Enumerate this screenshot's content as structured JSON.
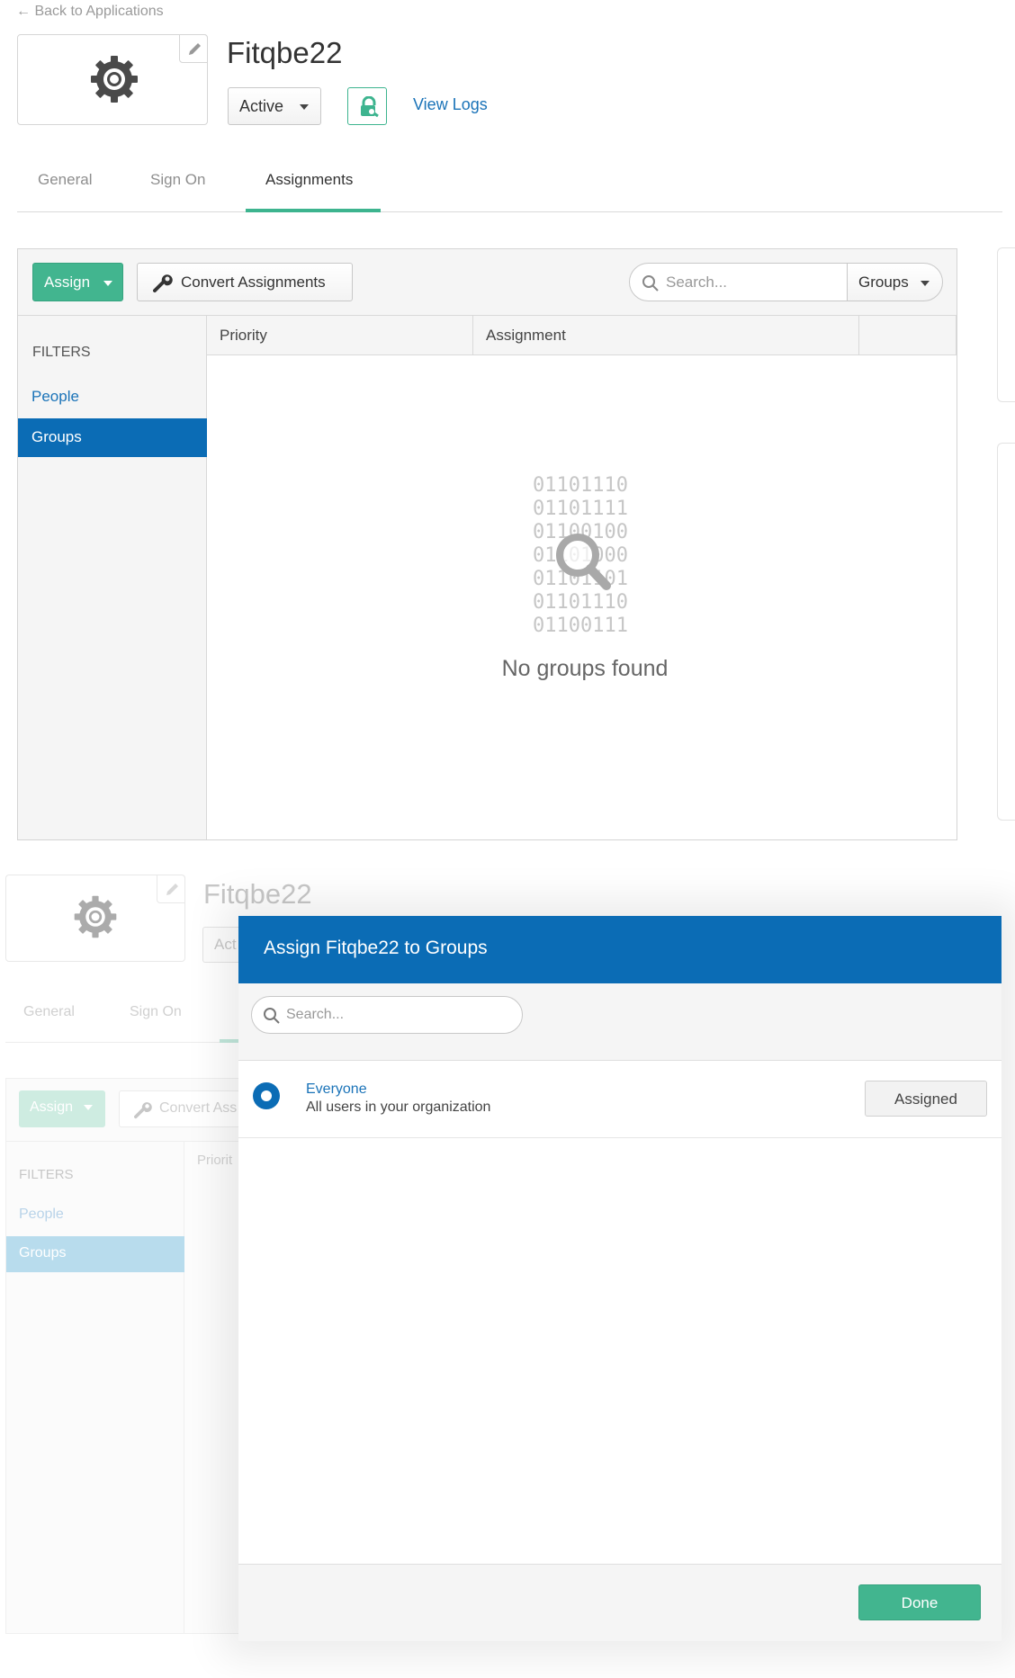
{
  "top": {
    "back_link": "← Back to Applications",
    "app_title": "Fitqbe22",
    "status": "Active",
    "view_logs": "View Logs",
    "tabs": [
      {
        "label": "General"
      },
      {
        "label": "Sign On"
      },
      {
        "label": "Assignments",
        "active": true
      }
    ],
    "toolbar": {
      "assign": "Assign",
      "convert": "Convert Assignments",
      "search_placeholder": "Search...",
      "filter": "Groups"
    },
    "filters_label": "FILTERS",
    "filters": [
      "People",
      "Groups"
    ],
    "selected_filter": "Groups",
    "columns": [
      "Priority",
      "Assignment"
    ],
    "empty_bits": [
      "01101110",
      "01101111",
      "01100100",
      "01101000",
      "01101101",
      "01101110",
      "01100111"
    ],
    "empty_text": "No groups found"
  },
  "background": {
    "app_title": "Fitqbe22",
    "status": "Act",
    "tabs": [
      "General",
      "Sign On"
    ],
    "assign": "Assign",
    "convert": "Convert Ass",
    "filters_label": "FILTERS",
    "people": "People",
    "groups": "Groups",
    "priority": "Priorit"
  },
  "modal": {
    "title": "Assign Fitqbe22 to Groups",
    "search_placeholder": "Search...",
    "rows": [
      {
        "name": "Everyone",
        "description": "All users in your organization",
        "action": "Assigned"
      }
    ],
    "done": "Done"
  },
  "colors": {
    "accent_green": "#42b58f",
    "accent_blue": "#0b6cb5",
    "link_blue": "#1a73b8"
  }
}
